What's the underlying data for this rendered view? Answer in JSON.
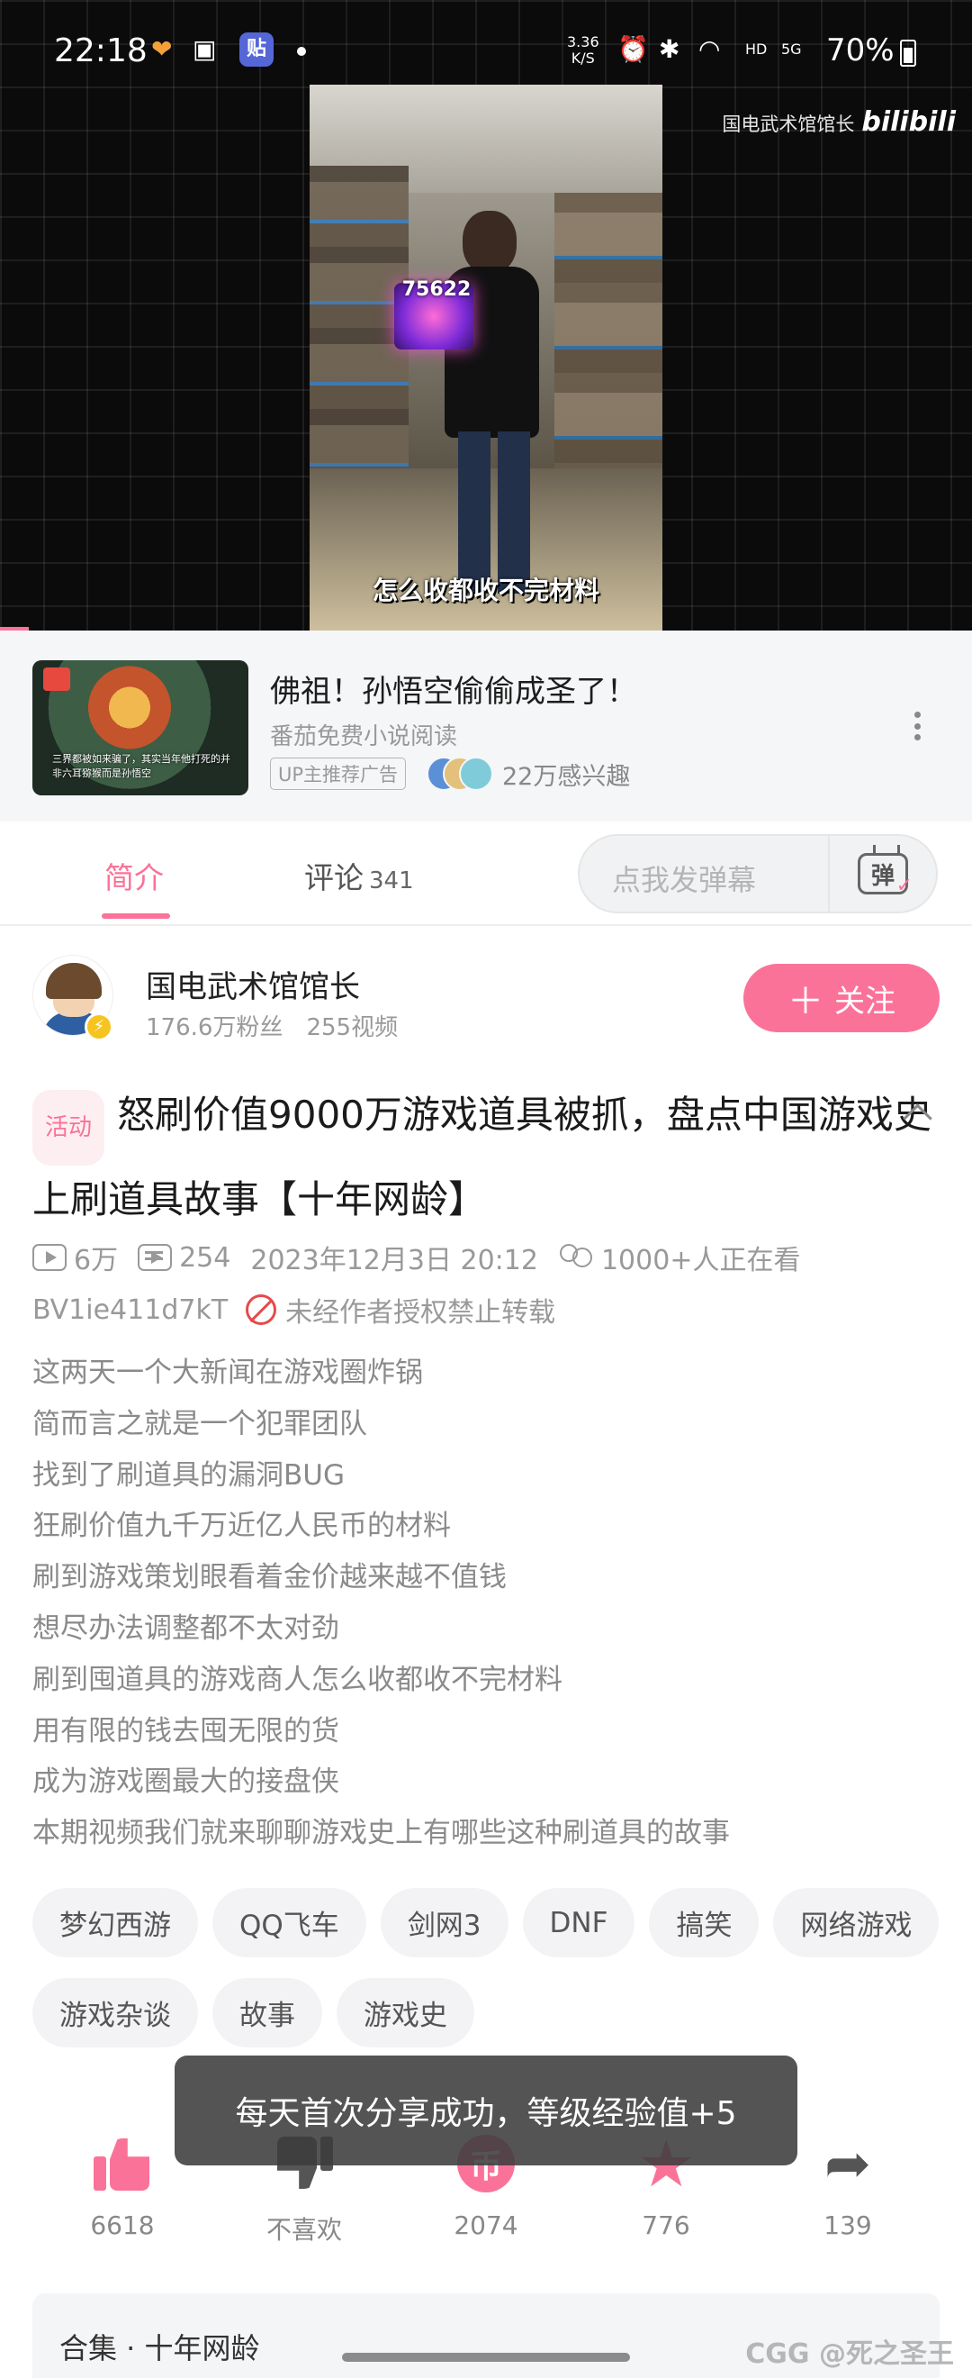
{
  "status_bar": {
    "time": "22:18",
    "app_badge": "贴",
    "net_speed_value": "3.36",
    "net_speed_unit": "K/S",
    "hd": "HD",
    "network": "5G",
    "battery": "70%"
  },
  "video": {
    "channel_watermark": "国电武术馆馆长",
    "logo": "bilibili",
    "subtitle": "怎么收都收不完材料",
    "overlay_price": "75622",
    "progress_fraction": 0.03
  },
  "ad": {
    "title": "佛祖！孙悟空偷偷成圣了！",
    "source": "番茄免费小说阅读",
    "tag": "UP主推荐广告",
    "interest": "22万感兴趣",
    "thumb_caption": "三界都被如来骗了，其实当年他打死的并非六耳猕猴而是孙悟空"
  },
  "tabs": {
    "intro": "简介",
    "comments": "评论",
    "comments_count": "341",
    "danmaku_placeholder": "点我发弹幕",
    "danmaku_icon_text": "弹"
  },
  "uploader": {
    "name": "国电武术馆馆长",
    "fans": "176.6万粉丝",
    "videos": "255视频",
    "follow_label": "关注",
    "follow_plus": "＋"
  },
  "video_info": {
    "activity_tag": "活动",
    "title": "怒刷价值9000万游戏道具被抓，盘点中国游戏史上刷道具故事【十年网龄】",
    "views": "6万",
    "danmaku_count": "254",
    "publish_time": "2023年12月3日 20:12",
    "watching": "1000+人正在看",
    "bvid": "BV1ie411d7kT",
    "copyright_notice": "未经作者授权禁止转载",
    "description": [
      "这两天一个大新闻在游戏圈炸锅",
      "简而言之就是一个犯罪团队",
      "找到了刷道具的漏洞BUG",
      "狂刷价值九千万近亿人民币的材料",
      "刷到游戏策划眼看着金价越来越不值钱",
      "想尽办法调整都不太对劲",
      "刷到囤道具的游戏商人怎么收都收不完材料",
      "用有限的钱去囤无限的货",
      "成为游戏圈最大的接盘侠",
      "本期视频我们就来聊聊游戏史上有哪些这种刷道具的故事"
    ],
    "tags": [
      "梦幻西游",
      "QQ飞车",
      "剑网3",
      "DNF",
      "搞笑",
      "网络游戏",
      "游戏杂谈",
      "故事",
      "游戏史"
    ]
  },
  "actions": {
    "like_count": "6618",
    "dislike_label": "不喜欢",
    "coin_count": "2074",
    "coin_symbol": "币",
    "favorite_count": "776",
    "share_count": "139"
  },
  "toast": "每天首次分享成功，等级经验值+5",
  "collection": {
    "label": "合集 · 十年网龄"
  },
  "corner_watermark": "CGG @死之圣王",
  "colors": {
    "accent": "#fb7299",
    "text_secondary": "#999999",
    "chip_bg": "#f3f3f5"
  }
}
